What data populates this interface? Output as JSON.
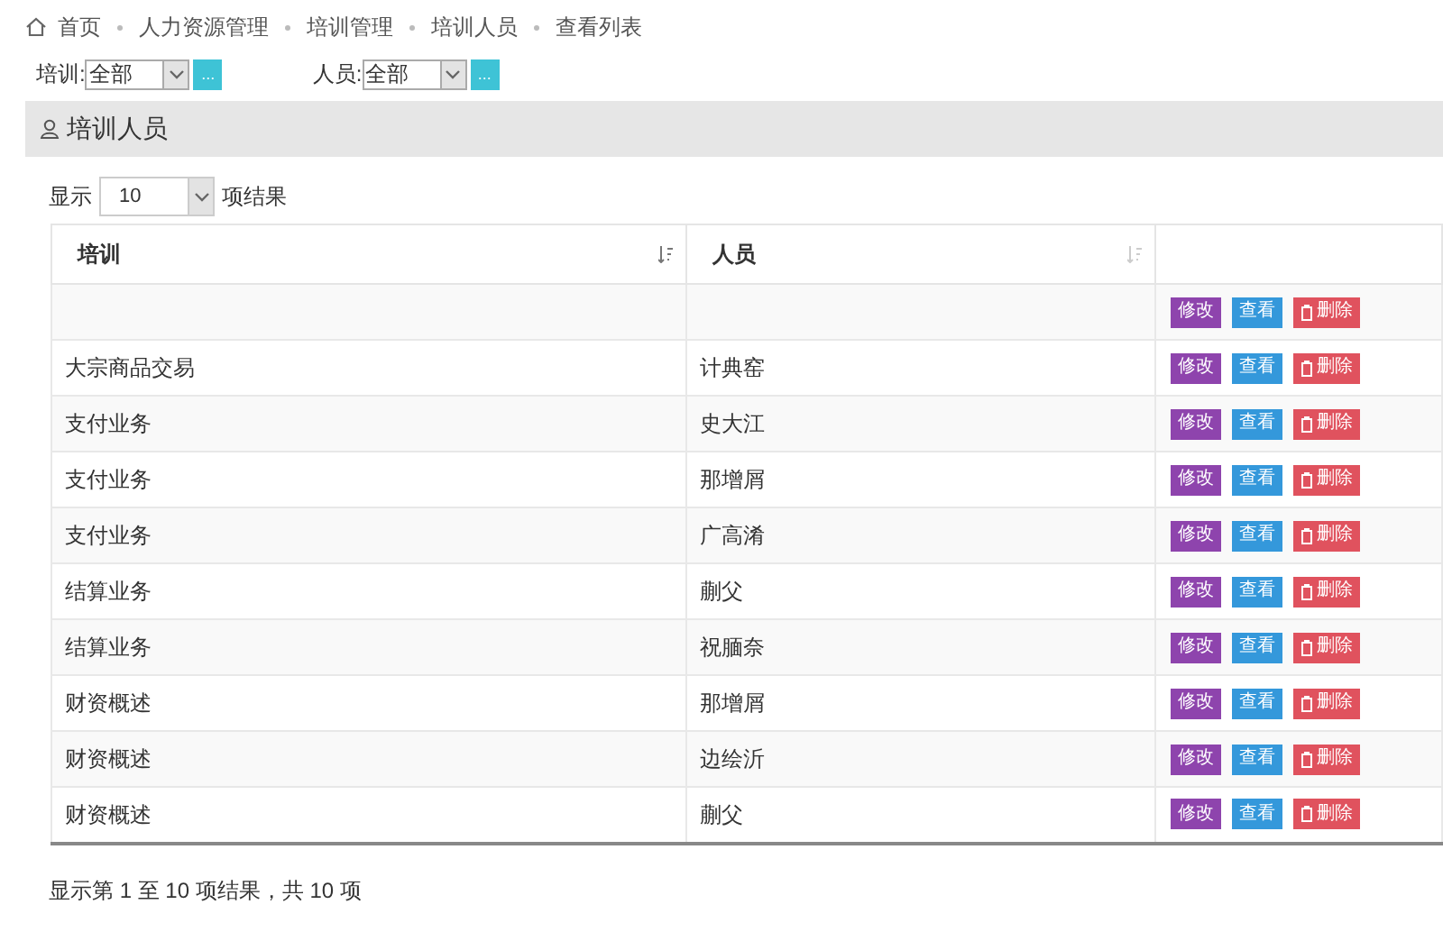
{
  "breadcrumb": [
    "首页",
    "人力资源管理",
    "培训管理",
    "培训人员",
    "查看列表"
  ],
  "filters": [
    {
      "label": "培训:",
      "value": "全部",
      "button": "..."
    },
    {
      "label": "人员:",
      "value": "全部",
      "button": "..."
    }
  ],
  "panel": {
    "title": "培训人员"
  },
  "page_length": {
    "prefix": "显示",
    "value": "10",
    "suffix": "项结果"
  },
  "table": {
    "columns": [
      "培训",
      "人员"
    ],
    "rows": [
      {
        "cells": [
          "",
          ""
        ],
        "actions": [
          "修改",
          "查看",
          "删除"
        ]
      },
      {
        "cells": [
          "大宗商品交易",
          "计典窑"
        ],
        "actions": [
          "修改",
          "查看",
          "删除"
        ]
      },
      {
        "cells": [
          "支付业务",
          "史大江"
        ],
        "actions": [
          "修改",
          "查看",
          "删除"
        ]
      },
      {
        "cells": [
          "支付业务",
          "那增屑"
        ],
        "actions": [
          "修改",
          "查看",
          "删除"
        ]
      },
      {
        "cells": [
          "支付业务",
          "广高淆"
        ],
        "actions": [
          "修改",
          "查看",
          "删除"
        ]
      },
      {
        "cells": [
          "结算业务",
          "蒯父"
        ],
        "actions": [
          "修改",
          "查看",
          "删除"
        ]
      },
      {
        "cells": [
          "结算业务",
          "祝腼奈"
        ],
        "actions": [
          "修改",
          "查看",
          "删除"
        ]
      },
      {
        "cells": [
          "财资概述",
          "那增屑"
        ],
        "actions": [
          "修改",
          "查看",
          "删除"
        ]
      },
      {
        "cells": [
          "财资概述",
          "边绘沂"
        ],
        "actions": [
          "修改",
          "查看",
          "删除"
        ]
      },
      {
        "cells": [
          "财资概述",
          "蒯父"
        ],
        "actions": [
          "修改",
          "查看",
          "删除"
        ]
      }
    ]
  },
  "footer": "显示第 1 至 10 项结果，共 10 项"
}
